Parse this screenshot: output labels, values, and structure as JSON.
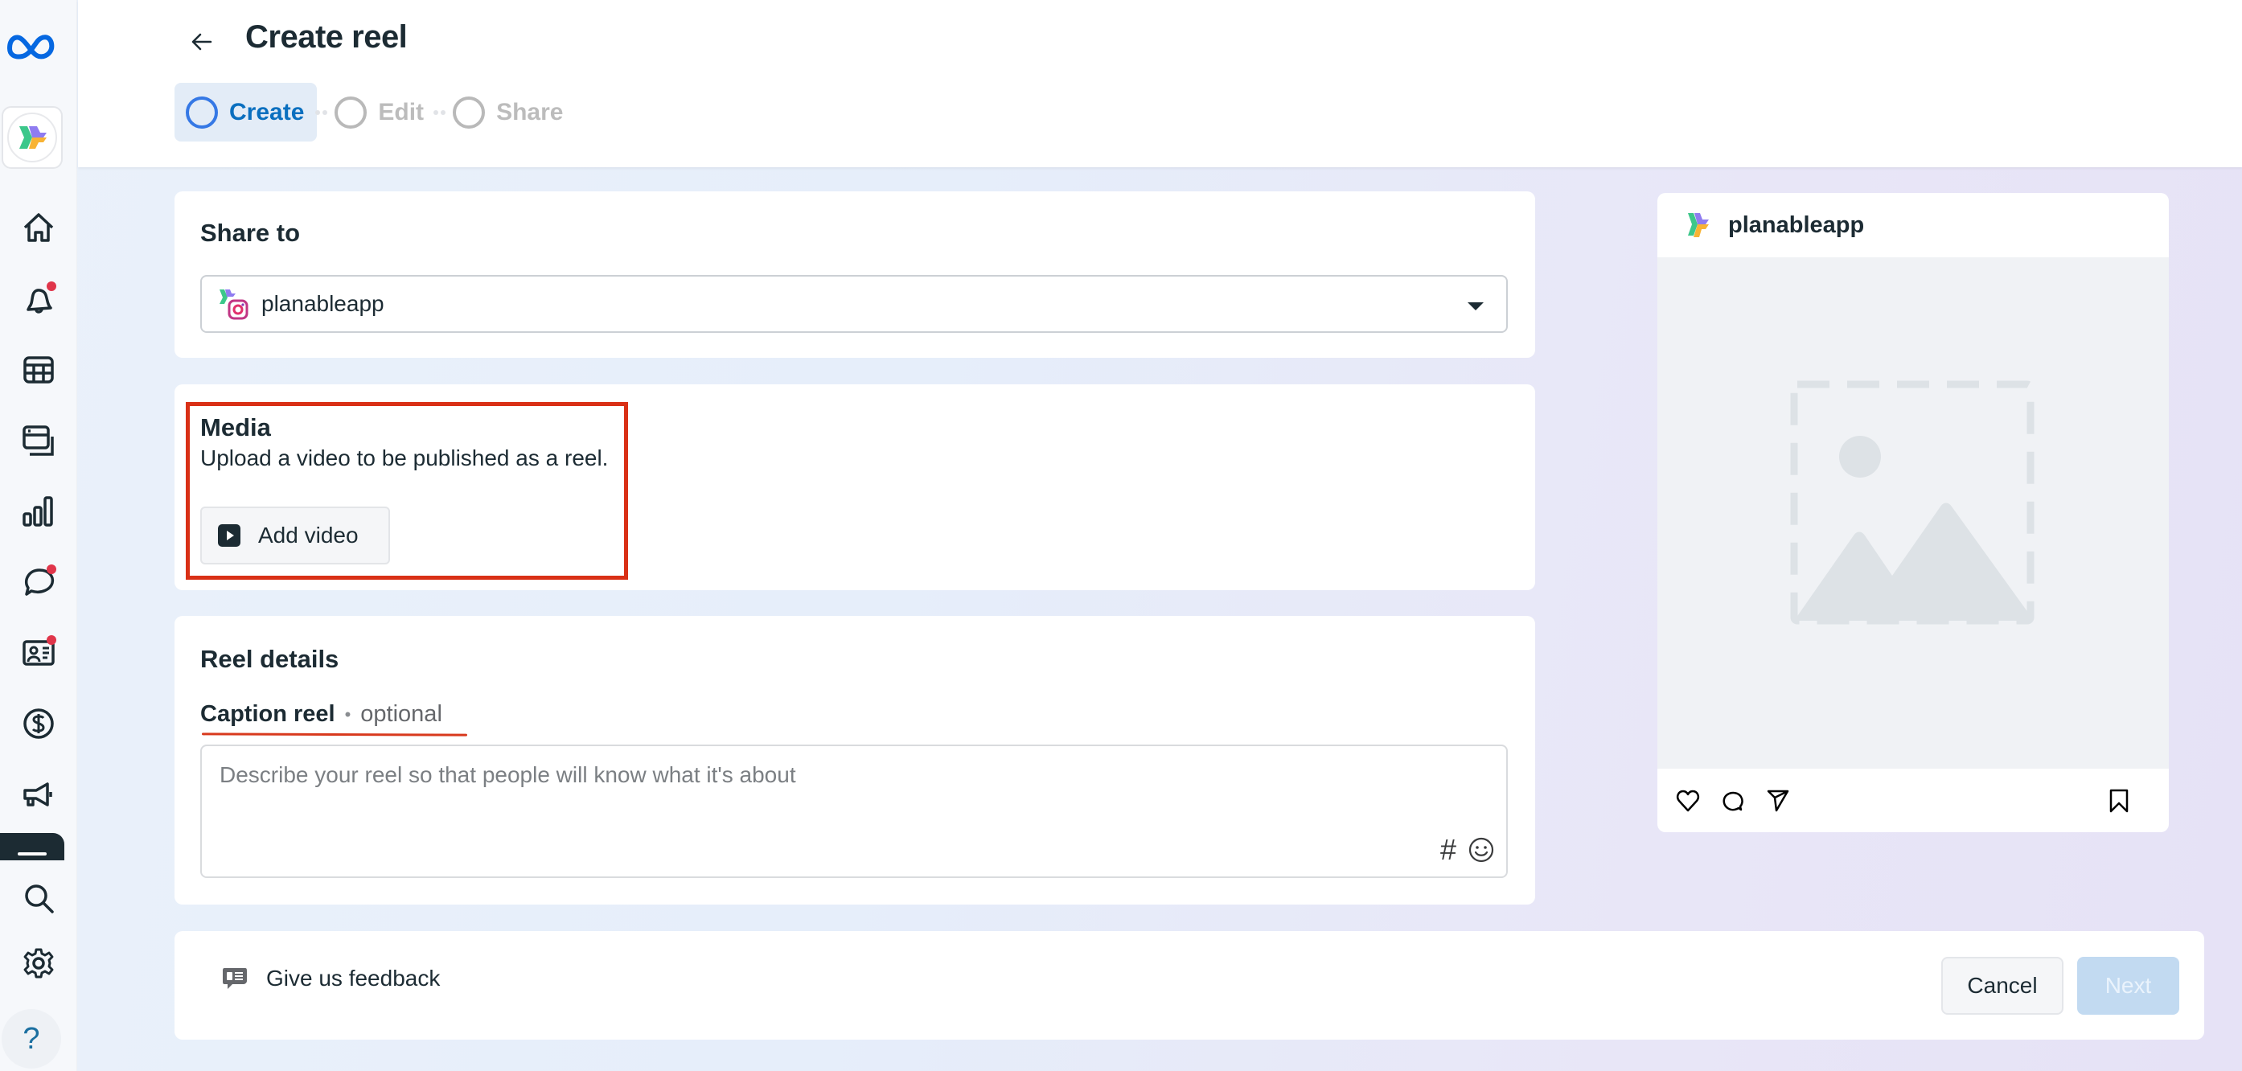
{
  "header": {
    "title": "Create reel",
    "steps": [
      {
        "label": "Create",
        "state": "active"
      },
      {
        "label": "Edit",
        "state": "inactive"
      },
      {
        "label": "Share",
        "state": "inactive"
      }
    ]
  },
  "sidebar": {
    "items": [
      {
        "name": "home",
        "icon": "home-icon",
        "badge": false
      },
      {
        "name": "notifications",
        "icon": "bell-icon",
        "badge": true
      },
      {
        "name": "planner",
        "icon": "calendar-grid-icon",
        "badge": false
      },
      {
        "name": "content",
        "icon": "content-stack-icon",
        "badge": false
      },
      {
        "name": "insights",
        "icon": "bar-chart-icon",
        "badge": false
      },
      {
        "name": "inbox",
        "icon": "chat-bubble-icon",
        "badge": true
      },
      {
        "name": "profile",
        "icon": "id-card-icon",
        "badge": true
      },
      {
        "name": "monetization",
        "icon": "dollar-icon",
        "badge": false
      },
      {
        "name": "ads",
        "icon": "megaphone-icon",
        "badge": false
      },
      {
        "name": "search",
        "icon": "search-icon",
        "badge": false
      },
      {
        "name": "settings",
        "icon": "gear-icon",
        "badge": false
      },
      {
        "name": "help",
        "icon": "help-icon",
        "badge": false
      }
    ],
    "help_glyph": "?"
  },
  "share_to": {
    "title": "Share to",
    "selected_account": "planableapp"
  },
  "media": {
    "title": "Media",
    "description": "Upload a video to be published as a reel.",
    "add_video_label": "Add video"
  },
  "reel_details": {
    "title": "Reel details",
    "caption_label": "Caption reel",
    "caption_separator": "•",
    "caption_optional": "optional",
    "caption_value": "",
    "caption_placeholder": "Describe your reel so that people will know what it's about",
    "hashtag_glyph": "#"
  },
  "preview": {
    "account_name": "planableapp"
  },
  "footer": {
    "feedback_label": "Give us feedback",
    "cancel_label": "Cancel",
    "next_label": "Next",
    "next_enabled": false
  },
  "colors": {
    "accent": "#0a6fbf",
    "step_active_bg": "#e3ecf7",
    "highlight_border": "#d93016",
    "notification_dot": "#e0354a",
    "next_disabled_bg": "#c2daf1",
    "meta_blue": "#0668e1"
  }
}
